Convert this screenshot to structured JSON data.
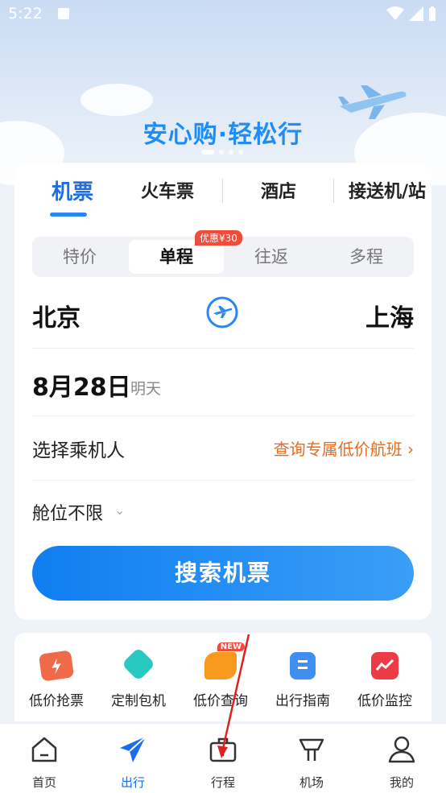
{
  "status_bar": {
    "time": "5:22"
  },
  "banner": {
    "slogan": "安心购·轻松行"
  },
  "tabs": [
    {
      "label": "机票",
      "active": true
    },
    {
      "label": "火车票"
    },
    {
      "label": "酒店"
    },
    {
      "label": "接送机/站"
    }
  ],
  "trip_types": [
    {
      "label": "特价"
    },
    {
      "label": "单程",
      "active": true,
      "badge": "优惠¥30"
    },
    {
      "label": "往返"
    },
    {
      "label": "多程"
    }
  ],
  "route": {
    "from": "北京",
    "to": "上海"
  },
  "date": {
    "main": "8月28日",
    "sub": "明天"
  },
  "passenger": {
    "label": "选择乘机人",
    "link": "查询专属低价航班"
  },
  "cabin": {
    "label": "舱位不限"
  },
  "search_button": "搜索机票",
  "quick_actions": [
    {
      "label": "低价抢票",
      "icon": "ticket-icon"
    },
    {
      "label": "定制包机",
      "icon": "charter-icon"
    },
    {
      "label": "低价查询",
      "icon": "price-query-icon",
      "badge": "NEW"
    },
    {
      "label": "出行指南",
      "icon": "guide-icon"
    },
    {
      "label": "低价监控",
      "icon": "monitor-icon"
    }
  ],
  "nav": [
    {
      "label": "首页",
      "icon": "home-icon"
    },
    {
      "label": "出行",
      "icon": "paper-plane-icon",
      "active": true
    },
    {
      "label": "行程",
      "icon": "suitcase-icon"
    },
    {
      "label": "机场",
      "icon": "airport-icon"
    },
    {
      "label": "我的",
      "icon": "user-icon"
    }
  ],
  "colors": {
    "accent": "#1a6ee8",
    "orange": "#ea6a1b",
    "badge_red": "#ef4d3b"
  }
}
